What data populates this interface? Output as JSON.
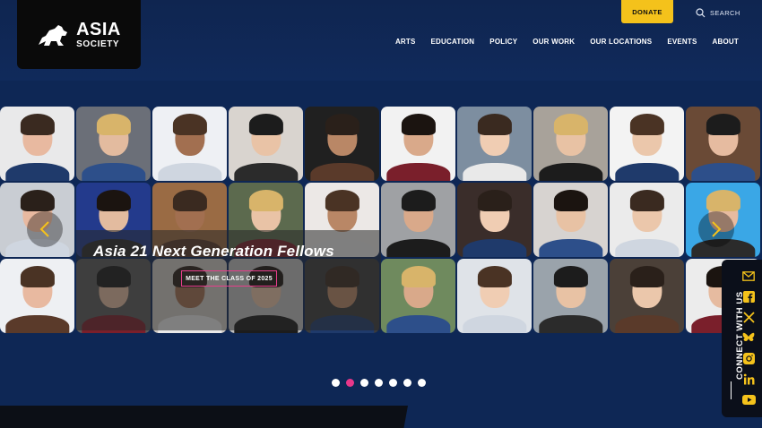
{
  "brand": {
    "line1": "ASIA",
    "line2": "SOCIETY"
  },
  "header": {
    "donate_label": "DONATE",
    "search_label": "SEARCH",
    "nav": [
      "ARTS",
      "EDUCATION",
      "POLICY",
      "OUR WORK",
      "OUR LOCATIONS",
      "EVENTS",
      "ABOUT"
    ]
  },
  "hero": {
    "title": "Asia 21 Next Generation Fellows",
    "cta_label": "MEET THE CLASS OF 2025",
    "slides_count": 7,
    "active_slide": 2
  },
  "social": {
    "label": "CONNECT WITH US",
    "icons": [
      "mail-icon",
      "facebook-icon",
      "x-icon",
      "bluesky-icon",
      "instagram-icon",
      "linkedin-icon",
      "youtube-icon"
    ]
  },
  "colors": {
    "navy": "#0e2755",
    "accent": "#f4c21b",
    "pink": "#e8378a",
    "social": "#f4c21b"
  }
}
